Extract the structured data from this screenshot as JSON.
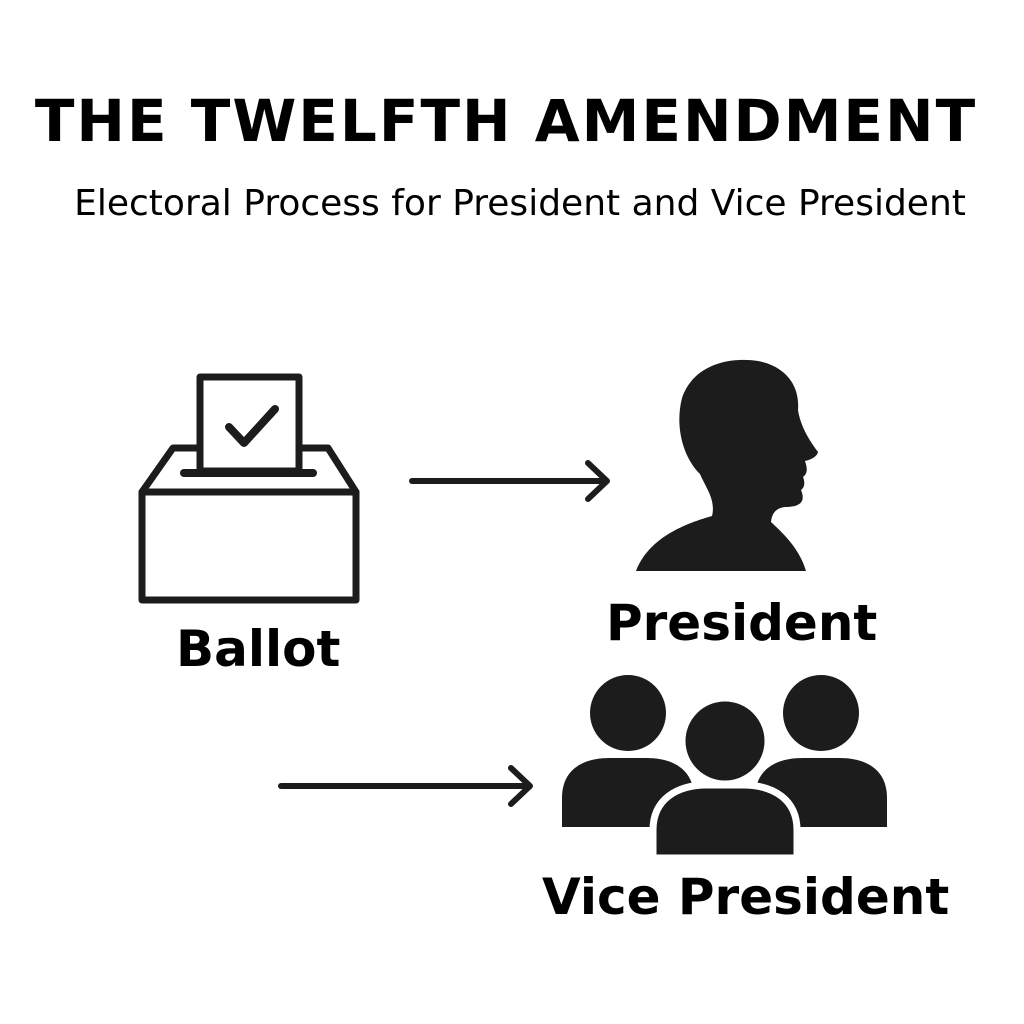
{
  "header": {
    "title": "THE TWELFTH AMENDMENT",
    "subtitle": "Electoral Process for President and Vice President"
  },
  "nodes": {
    "ballot": {
      "label": "Ballot",
      "icon": "ballot-box-icon"
    },
    "president": {
      "label": "President",
      "icon": "person-profile-icon"
    },
    "vice_president": {
      "label": "Vice President",
      "icon": "group-people-icon"
    }
  },
  "colors": {
    "ink": "#1c1c1c",
    "background": "#ffffff"
  }
}
